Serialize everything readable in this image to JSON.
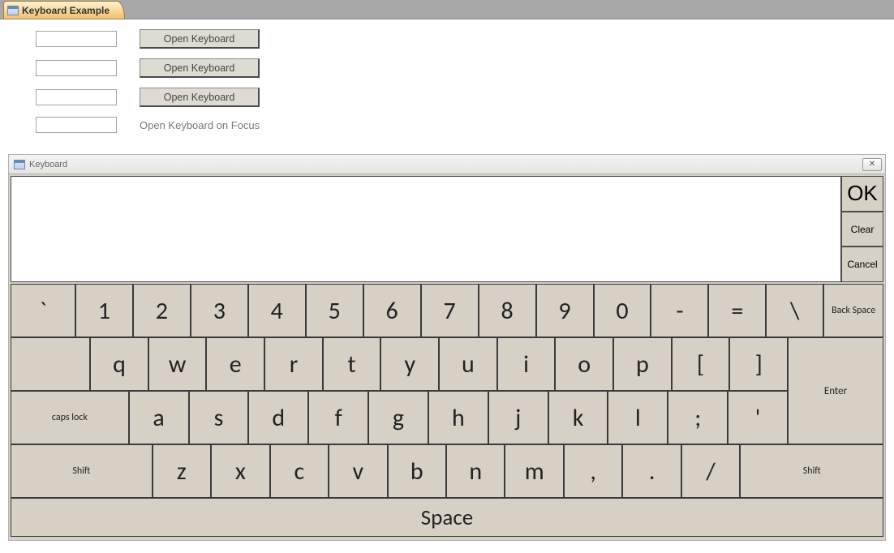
{
  "form": {
    "tab_title": "Keyboard Example",
    "rows": [
      {
        "btn": "Open Keyboard"
      },
      {
        "btn": "Open Keyboard"
      },
      {
        "btn": "Open Keyboard"
      }
    ],
    "focus_label": "Open Keyboard on Focus"
  },
  "keyboard": {
    "title": "Keyboard",
    "side": {
      "ok": "OK",
      "clear": "Clear",
      "cancel": "Cancel"
    },
    "row1": {
      "keys": [
        "`",
        "1",
        "2",
        "3",
        "4",
        "5",
        "6",
        "7",
        "8",
        "9",
        "0",
        "-",
        "=",
        "\\"
      ],
      "backspace": "Back Space"
    },
    "row2": {
      "keys": [
        "q",
        "w",
        "e",
        "r",
        "t",
        "y",
        "u",
        "i",
        "o",
        "p",
        "[",
        "]"
      ],
      "enter": "Enter"
    },
    "row3": {
      "caps": "caps lock",
      "keys": [
        "a",
        "s",
        "d",
        "f",
        "g",
        "h",
        "j",
        "k",
        "l",
        ";",
        "'"
      ]
    },
    "row4": {
      "shift_l": "Shift",
      "keys": [
        "z",
        "x",
        "c",
        "v",
        "b",
        "n",
        "m",
        ",",
        ".",
        "/"
      ],
      "shift_r": "Shift"
    },
    "row5": {
      "space": "Space"
    }
  }
}
